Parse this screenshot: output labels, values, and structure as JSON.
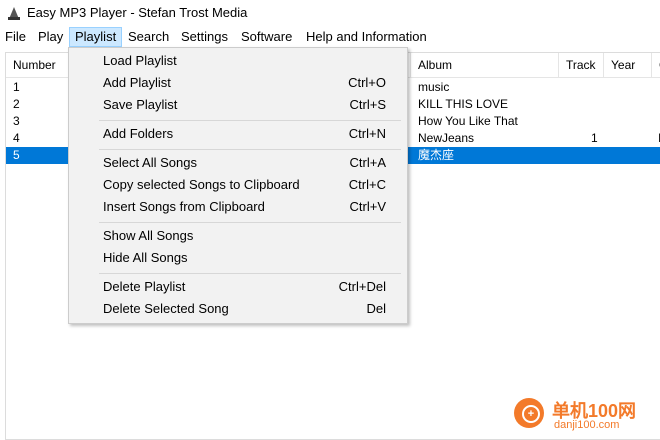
{
  "window": {
    "title": "Easy MP3 Player - Stefan Trost Media",
    "icon": "mp3-player-icon"
  },
  "menubar": [
    {
      "label": "File"
    },
    {
      "label": "Play"
    },
    {
      "label": "Playlist"
    },
    {
      "label": "Search"
    },
    {
      "label": "Settings"
    },
    {
      "label": "Software"
    },
    {
      "label": "Help and Information"
    }
  ],
  "table": {
    "headers": {
      "number": "Number",
      "album": "Album",
      "track": "Track",
      "year": "Year",
      "extra": "G"
    },
    "rows": [
      {
        "number": "1",
        "album": "music",
        "track": "",
        "year": "",
        "extra": ""
      },
      {
        "number": "2",
        "album": "KILL THIS LOVE",
        "track": "",
        "year": "",
        "extra": ""
      },
      {
        "number": "3",
        "album": "How You Like That",
        "track": "",
        "year": "",
        "extra": ""
      },
      {
        "number": "4",
        "album": "NewJeans",
        "track": "1",
        "year": "",
        "extra": "I"
      },
      {
        "number": "5",
        "album": "魔杰座",
        "track": "",
        "year": "",
        "extra": ""
      }
    ],
    "selected_row": 5
  },
  "playlist_menu": {
    "items": [
      {
        "label": "Load Playlist",
        "shortcut": ""
      },
      {
        "label": "Add Playlist",
        "shortcut": "Ctrl+O"
      },
      {
        "label": "Save Playlist",
        "shortcut": "Ctrl+S"
      },
      {
        "label": "Add Folders",
        "shortcut": "Ctrl+N"
      },
      {
        "label": "Select All Songs",
        "shortcut": "Ctrl+A"
      },
      {
        "label": "Copy selected Songs to Clipboard",
        "shortcut": "Ctrl+C"
      },
      {
        "label": "Insert Songs from Clipboard",
        "shortcut": "Ctrl+V"
      },
      {
        "label": "Show All Songs",
        "shortcut": ""
      },
      {
        "label": "Hide All Songs",
        "shortcut": ""
      },
      {
        "label": "Delete Playlist",
        "shortcut": "Ctrl+Del"
      },
      {
        "label": "Delete Selected Song",
        "shortcut": "Del"
      }
    ]
  },
  "watermark": {
    "brand": "单机100网",
    "url": "danji100.com"
  },
  "colors": {
    "selection": "#0078d7",
    "menu_highlight": "#cce8ff",
    "watermark": "#f37a2a"
  }
}
